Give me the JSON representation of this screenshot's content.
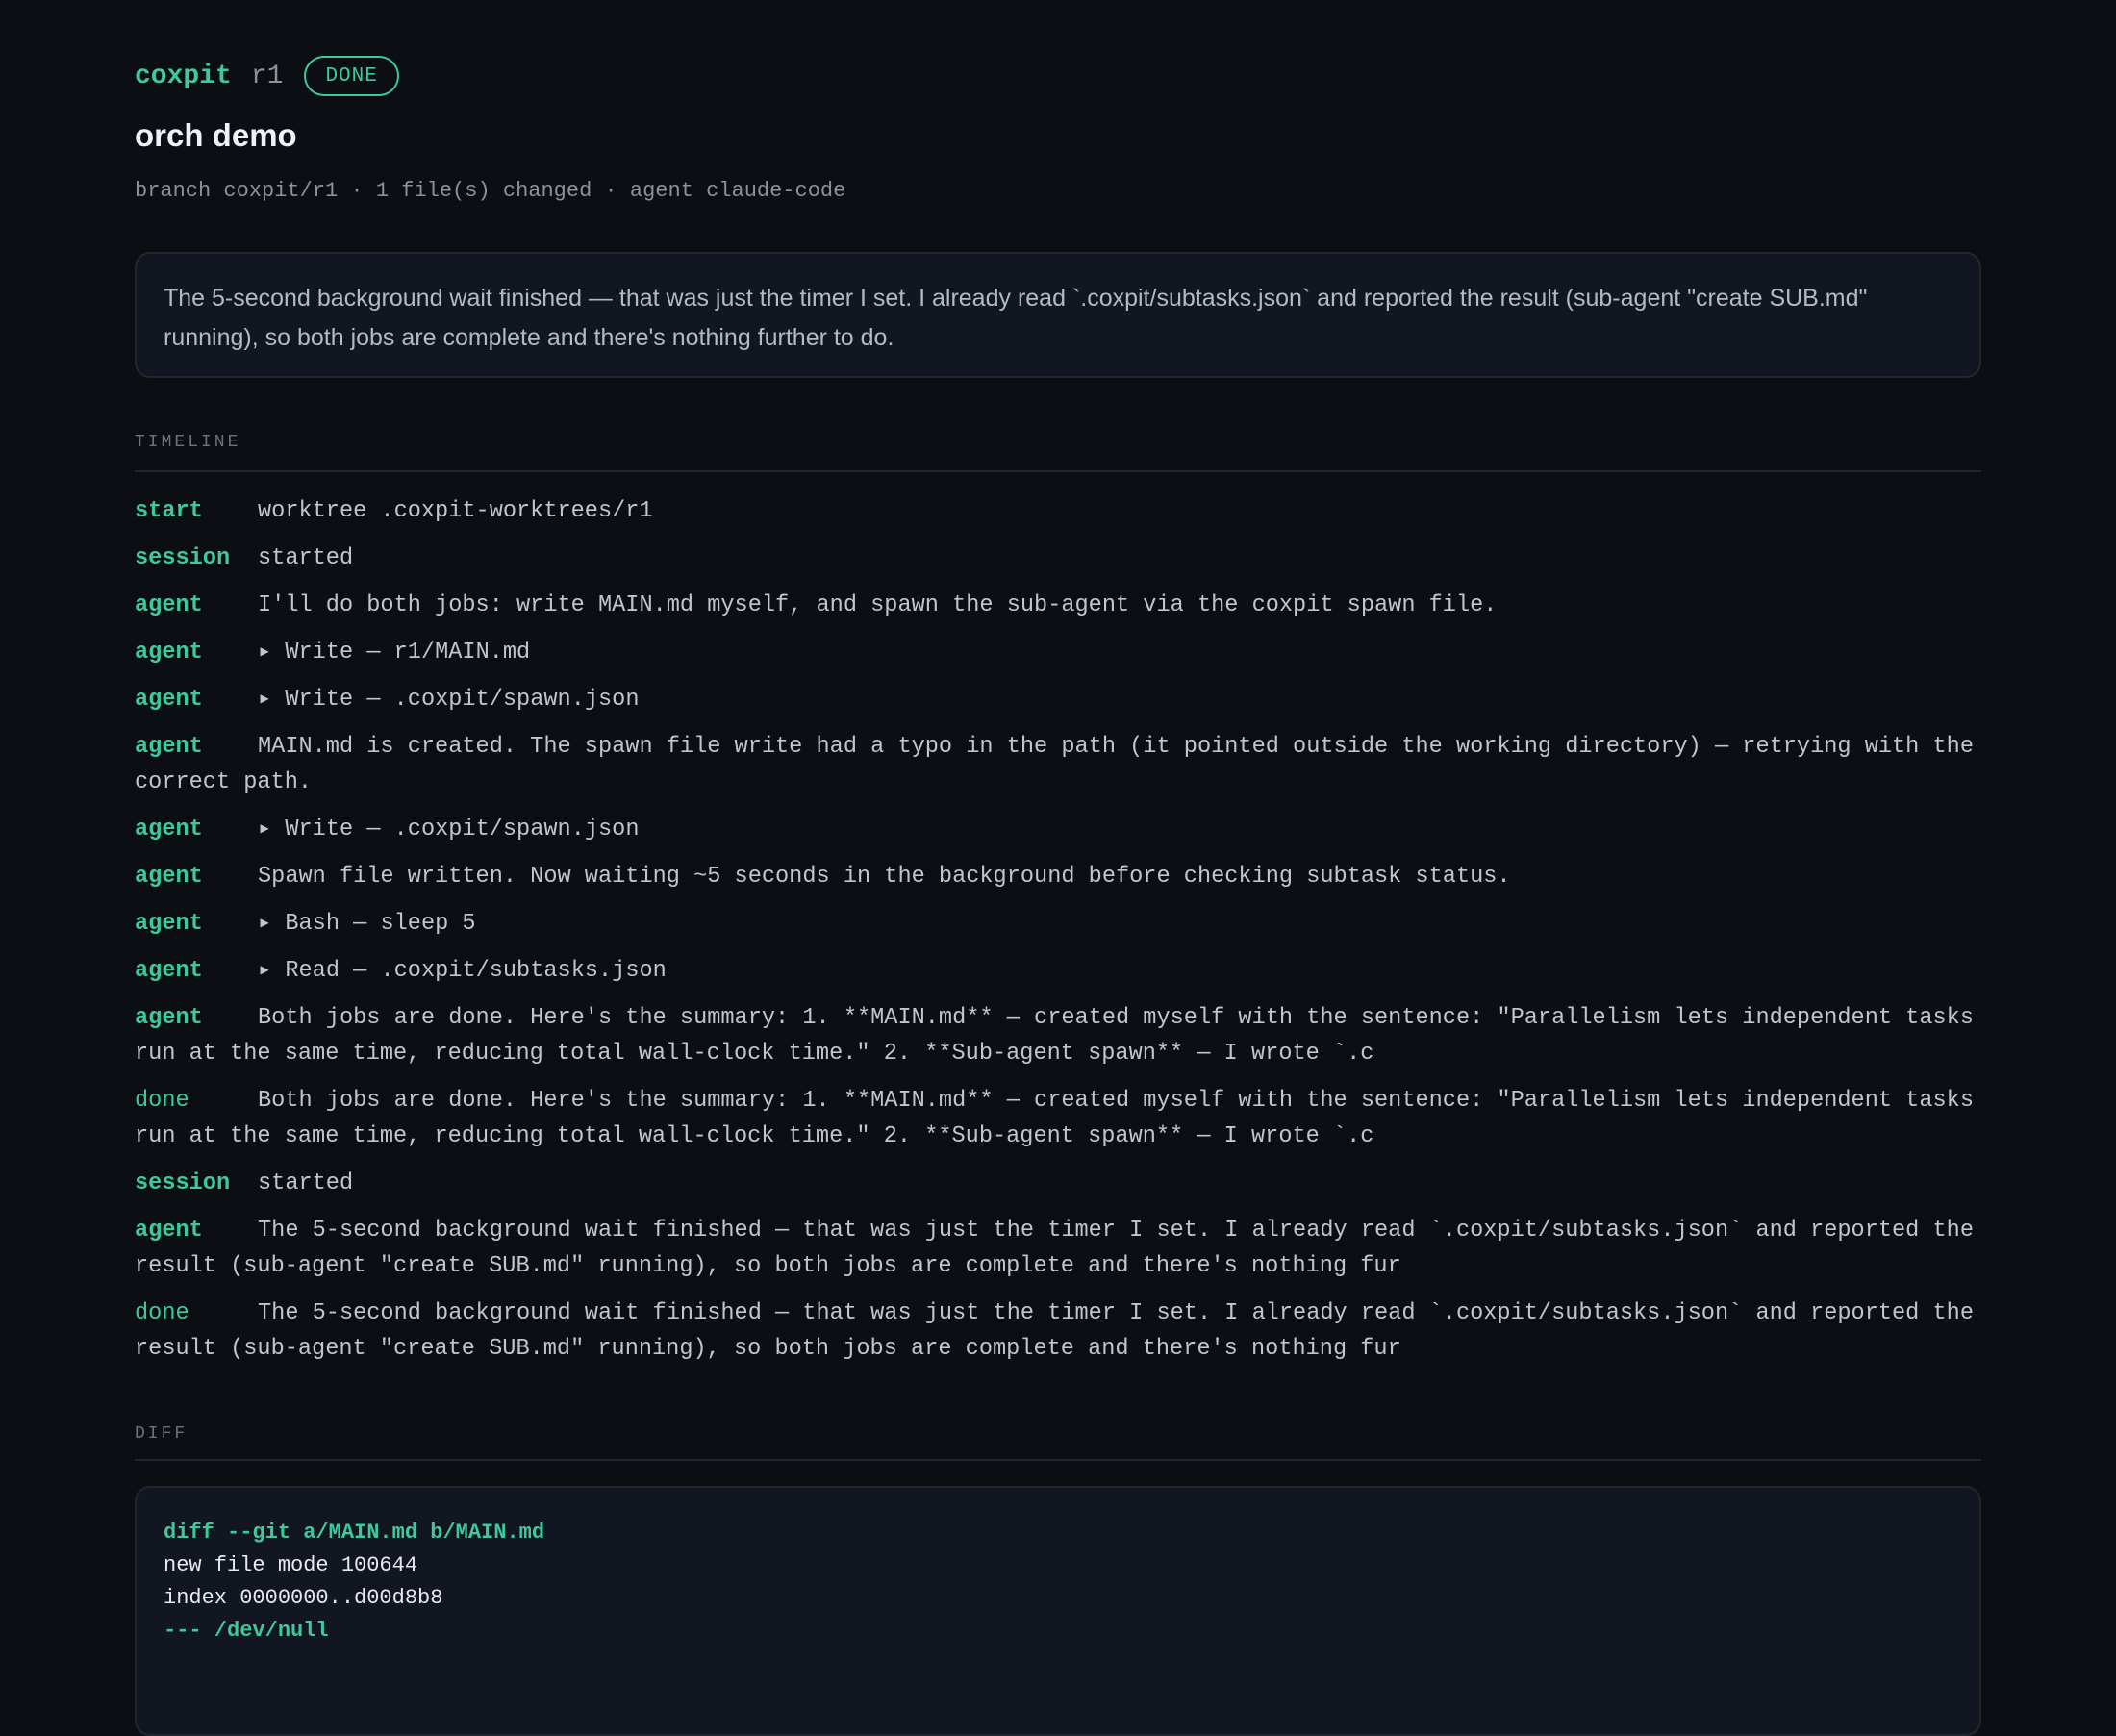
{
  "header": {
    "app_name": "coxpit",
    "run_id": "r1",
    "status": "DONE",
    "title": "orch demo",
    "meta": "branch coxpit/r1 · 1 file(s) changed · agent claude-code"
  },
  "summary": "The 5-second background wait finished — that was just the timer I set. I already read `.coxpit/subtasks.json` and reported the result (sub-agent \"create SUB.md\" running), so both jobs are complete and there's nothing further to do.",
  "timeline": {
    "label": "TIMELINE",
    "events": [
      {
        "kind": "start",
        "text": "worktree .coxpit-worktrees/r1"
      },
      {
        "kind": "session",
        "text": "started"
      },
      {
        "kind": "agent",
        "text": "I'll do both jobs: write MAIN.md myself, and spawn the sub-agent via the coxpit spawn file."
      },
      {
        "kind": "agent",
        "text": "▸ Write — r1/MAIN.md"
      },
      {
        "kind": "agent",
        "text": "▸ Write — .coxpit/spawn.json"
      },
      {
        "kind": "agent",
        "text": "MAIN.md is created. The spawn file write had a typo in the path (it pointed outside the working directory) — retrying with the correct path."
      },
      {
        "kind": "agent",
        "text": "▸ Write — .coxpit/spawn.json"
      },
      {
        "kind": "agent",
        "text": "Spawn file written. Now waiting ~5 seconds in the background before checking subtask status."
      },
      {
        "kind": "agent",
        "text": "▸ Bash — sleep 5"
      },
      {
        "kind": "agent",
        "text": "▸ Read — .coxpit/subtasks.json"
      },
      {
        "kind": "agent",
        "text": "Both jobs are done. Here's the summary: 1. **MAIN.md** — created myself with the sentence: \"Parallelism lets independent tasks run at the same time, reducing total wall-clock time.\" 2. **Sub-agent spawn** — I wrote `.c"
      },
      {
        "kind": "done",
        "text": "Both jobs are done. Here's the summary: 1. **MAIN.md** — created myself with the sentence: \"Parallelism lets independent tasks run at the same time, reducing total wall-clock time.\" 2. **Sub-agent spawn** — I wrote `.c"
      },
      {
        "kind": "session",
        "text": "started"
      },
      {
        "kind": "agent",
        "text": "The 5-second background wait finished — that was just the timer I set. I already read `.coxpit/subtasks.json` and reported the result (sub-agent \"create SUB.md\" running), so both jobs are complete and there's nothing fur"
      },
      {
        "kind": "done",
        "text": "The 5-second background wait finished — that was just the timer I set. I already read `.coxpit/subtasks.json` and reported the result (sub-agent \"create SUB.md\" running), so both jobs are complete and there's nothing fur"
      }
    ]
  },
  "diff": {
    "label": "DIFF",
    "lines": [
      {
        "text": "diff --git a/MAIN.md b/MAIN.md",
        "highlight": true
      },
      {
        "text": "new file mode 100644",
        "highlight": false
      },
      {
        "text": "index 0000000..d00d8b8",
        "highlight": false
      },
      {
        "text": "--- /dev/null",
        "highlight": true
      }
    ]
  },
  "colors": {
    "background": "#0b0e13",
    "accent": "#3ec99b",
    "panel": "#121620",
    "border": "#22272f",
    "muted": "#8b929c"
  }
}
